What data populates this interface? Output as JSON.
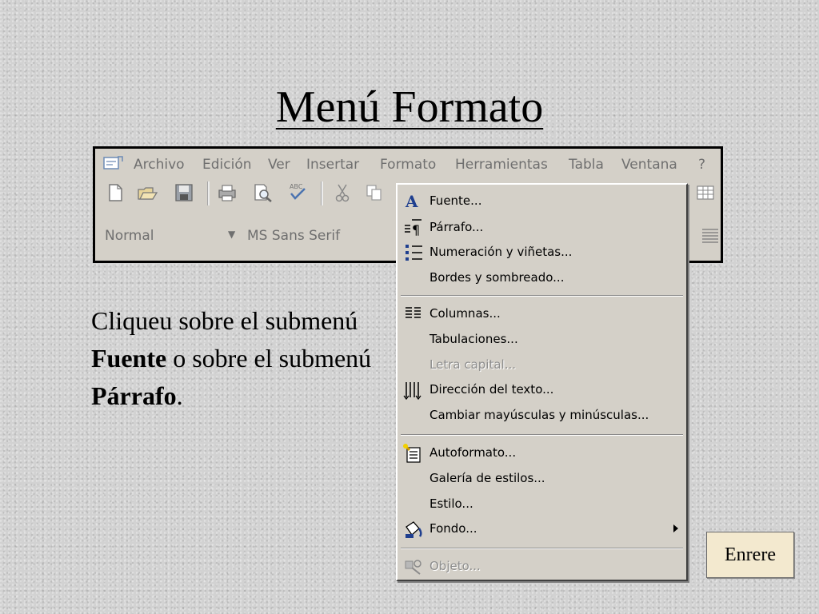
{
  "title": "Menú Formato",
  "menubar": [
    "Archivo",
    "Edición",
    "Ver",
    "Insertar",
    "Formato",
    "Herramientas",
    "Tabla",
    "Ventana",
    "?"
  ],
  "format_bar": {
    "style": "Normal",
    "font": "MS Sans Serif"
  },
  "menu": {
    "items": [
      {
        "label": "Fuente...",
        "icon": "font-icon"
      },
      {
        "label": "Párrafo...",
        "icon": "paragraph-icon"
      },
      {
        "label": "Numeración y viñetas...",
        "icon": "bullets-icon"
      },
      {
        "label": "Bordes y sombreado..."
      },
      {
        "label": "Columnas...",
        "icon": "columns-icon"
      },
      {
        "label": "Tabulaciones..."
      },
      {
        "label": "Letra capital...",
        "disabled": true
      },
      {
        "label": "Dirección del texto...",
        "icon": "text-direction-icon"
      },
      {
        "label": "Cambiar mayúsculas y minúsculas..."
      },
      {
        "label": "Autoformato...",
        "icon": "autoformat-icon"
      },
      {
        "label": "Galería de estilos..."
      },
      {
        "label": "Estilo..."
      },
      {
        "label": "Fondo...",
        "icon": "background-icon",
        "submenu": true
      },
      {
        "label": "Objeto...",
        "icon": "object-icon",
        "disabled": true
      }
    ]
  },
  "instruction": {
    "part1": "Cliqueu sobre el submenú ",
    "bold1": "Fuente",
    "part2": " o sobre el submenú ",
    "bold2": "Párrafo",
    "part3": "."
  },
  "next_button": "Enrere"
}
